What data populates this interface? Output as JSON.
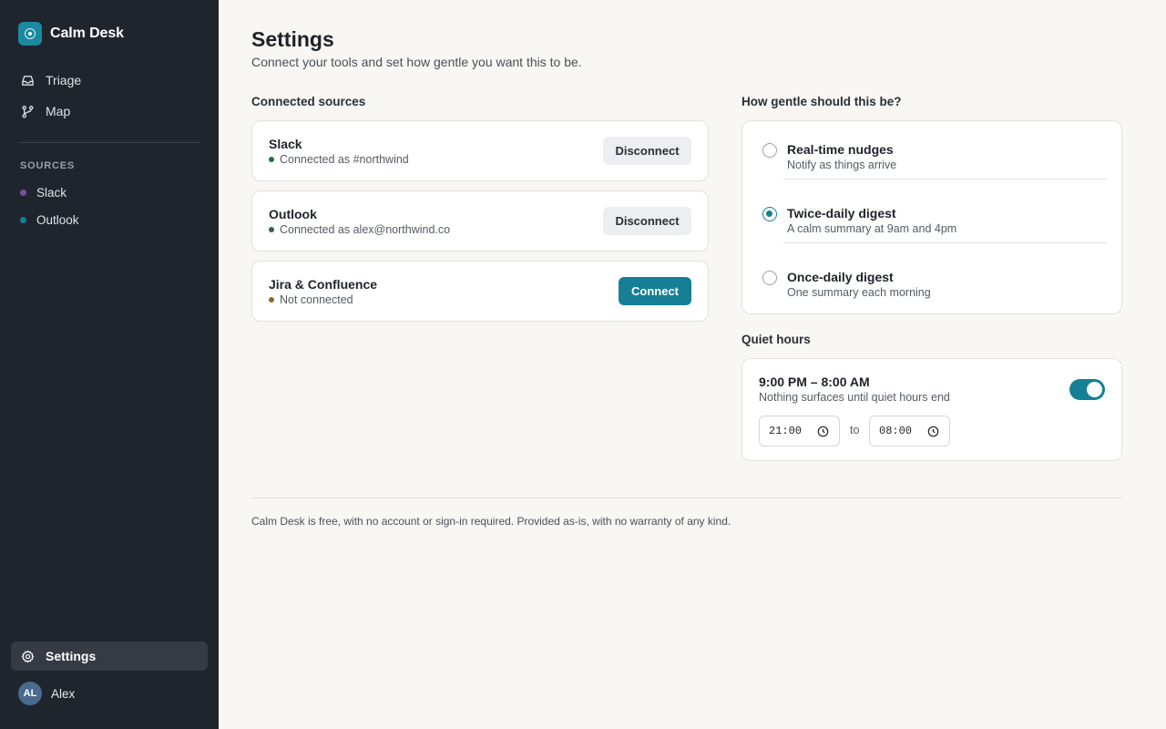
{
  "app": {
    "name": "Calm Desk"
  },
  "sidebar": {
    "nav": [
      {
        "label": "Triage",
        "icon": "inbox-icon"
      },
      {
        "label": "Map",
        "icon": "branch-icon"
      }
    ],
    "sources_heading": "SOURCES",
    "sources": [
      {
        "label": "Slack",
        "color": "#7b4f96"
      },
      {
        "label": "Outlook",
        "color": "#167f96"
      }
    ],
    "settings_label": "Settings",
    "user": {
      "initials": "AL",
      "name": "Alex"
    }
  },
  "header": {
    "title": "Settings",
    "subtitle": "Connect your tools and set how gentle you want this to be."
  },
  "connected": {
    "heading": "Connected sources",
    "items": [
      {
        "name": "Slack",
        "status": "Connected as #northwind",
        "status_color": "#2f6b3a",
        "action": "Disconnect"
      },
      {
        "name": "Outlook",
        "status": "Connected as alex@northwind.co",
        "status_color": "#2f6b3a",
        "action": "Disconnect"
      },
      {
        "name": "Jira & Confluence",
        "status": "Not connected",
        "status_color": "#8a6a1f",
        "action": "Connect"
      }
    ]
  },
  "gentle": {
    "heading": "How gentle should this be?",
    "options": [
      {
        "title": "Real-time nudges",
        "desc": "Notify as things arrive",
        "selected": false
      },
      {
        "title": "Twice-daily digest",
        "desc": "A calm summary at 9am and 4pm",
        "selected": true
      },
      {
        "title": "Once-daily digest",
        "desc": "One summary each morning",
        "selected": false
      }
    ]
  },
  "quiet": {
    "heading": "Quiet hours",
    "range": "9:00 PM – 8:00 AM",
    "desc": "Nothing surfaces until quiet hours end",
    "enabled": true,
    "start": "21:00",
    "to": "to",
    "end": "08:00"
  },
  "footer": {
    "text": "Calm Desk is free, with no account or sign-in required. Provided as-is, with no warranty of any kind."
  },
  "colors": {
    "accent": "#167f96",
    "sidebar_bg": "#1f252d",
    "page_bg": "#f8f7f4"
  }
}
